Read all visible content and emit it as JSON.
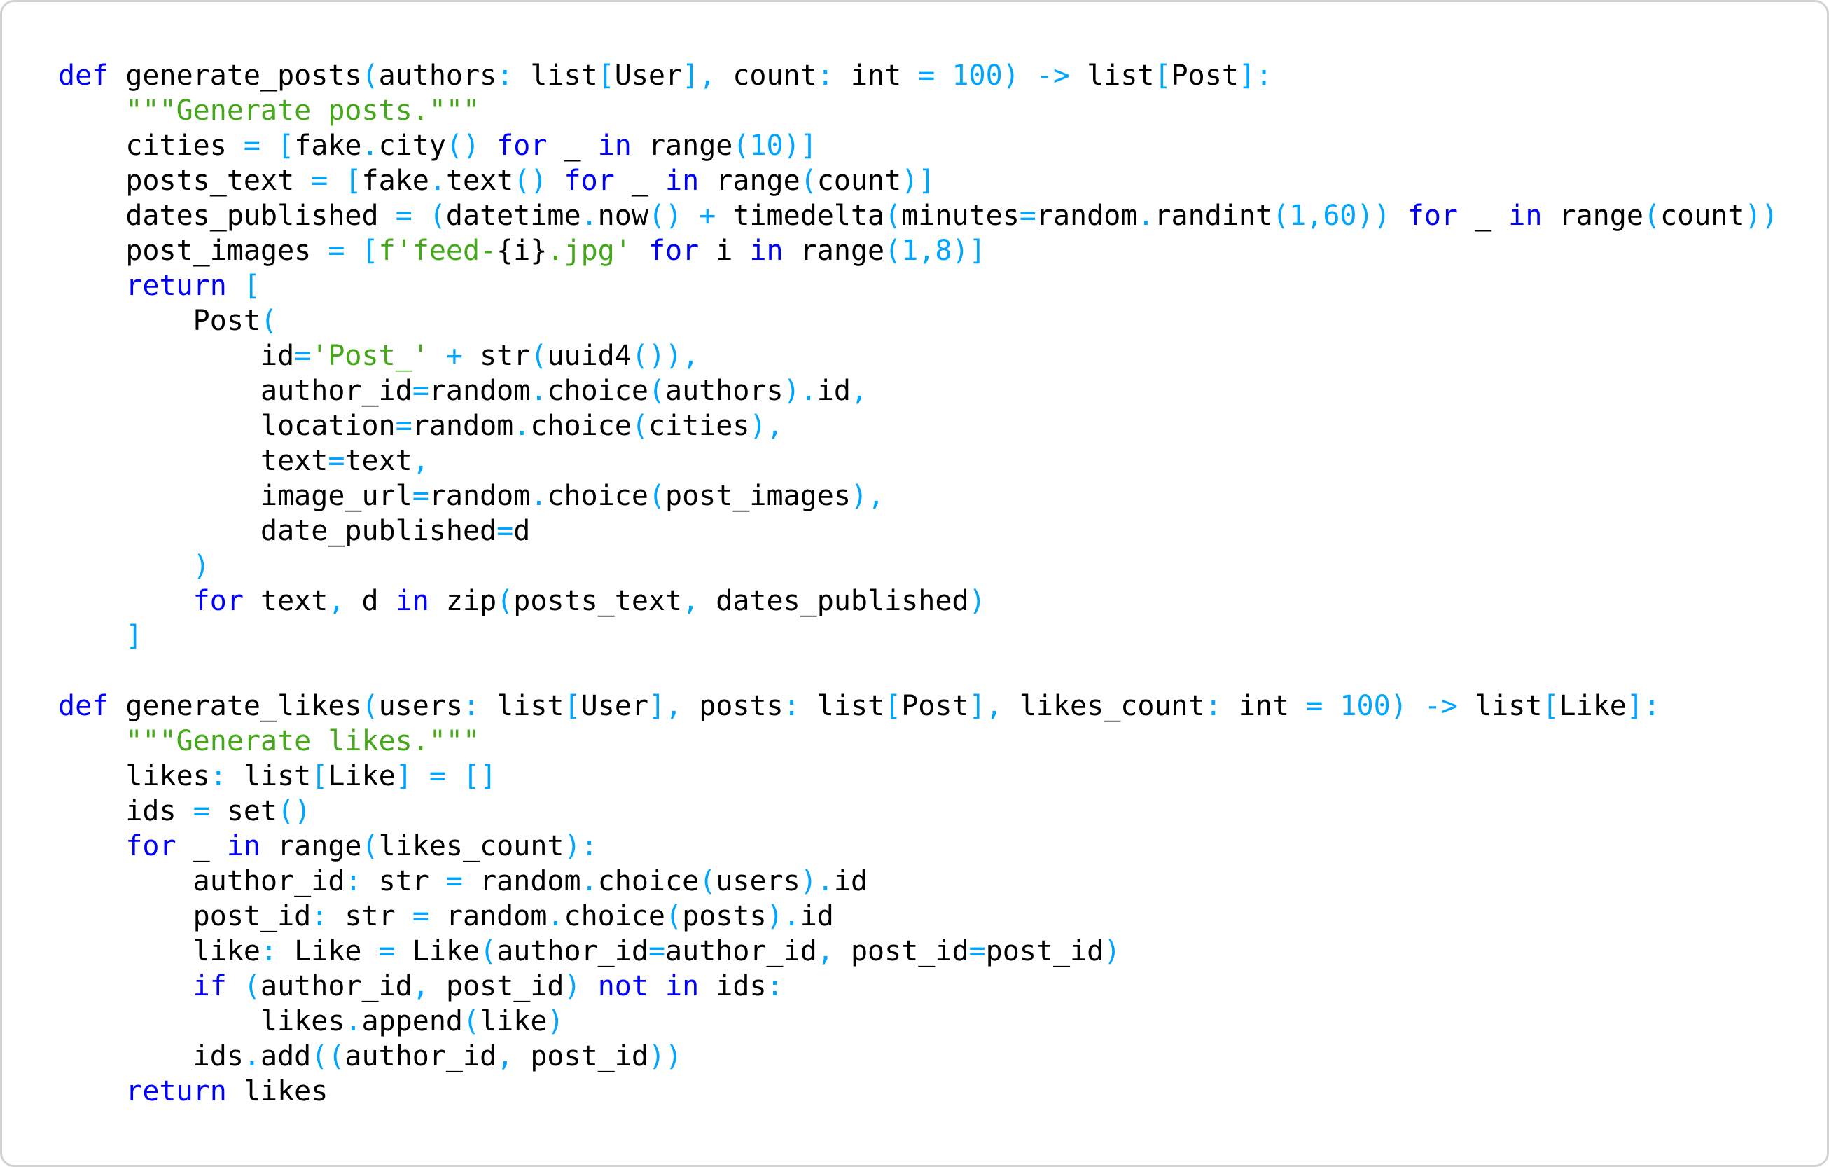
{
  "editor": {
    "language": "python",
    "colors": {
      "keyword": "#0000ff",
      "operator": "#00a5ff",
      "number": "#00a5ff",
      "string": "#44a81a",
      "text": "#000000",
      "background": "#ffffff",
      "border": "#d3d3d3"
    },
    "lines": [
      [
        [
          "kw",
          "def"
        ],
        [
          "tx",
          " generate_posts"
        ],
        [
          "op",
          "("
        ],
        [
          "tx",
          "authors"
        ],
        [
          "op",
          ":"
        ],
        [
          "tx",
          " list"
        ],
        [
          "op",
          "["
        ],
        [
          "tx",
          "User"
        ],
        [
          "op",
          "],"
        ],
        [
          "tx",
          " count"
        ],
        [
          "op",
          ":"
        ],
        [
          "tx",
          " int "
        ],
        [
          "op",
          "="
        ],
        [
          "tx",
          " "
        ],
        [
          "num",
          "100"
        ],
        [
          "op",
          ")"
        ],
        [
          "tx",
          " "
        ],
        [
          "op",
          "->"
        ],
        [
          "tx",
          " list"
        ],
        [
          "op",
          "["
        ],
        [
          "tx",
          "Post"
        ],
        [
          "op",
          "]:"
        ]
      ],
      [
        [
          "tx",
          "    "
        ],
        [
          "str",
          "\"\"\"Generate posts.\"\"\""
        ]
      ],
      [
        [
          "tx",
          "    cities "
        ],
        [
          "op",
          "="
        ],
        [
          "tx",
          " "
        ],
        [
          "op",
          "["
        ],
        [
          "tx",
          "fake"
        ],
        [
          "op",
          "."
        ],
        [
          "tx",
          "city"
        ],
        [
          "op",
          "()"
        ],
        [
          "tx",
          " "
        ],
        [
          "kw",
          "for"
        ],
        [
          "tx",
          " _ "
        ],
        [
          "kw",
          "in"
        ],
        [
          "tx",
          " range"
        ],
        [
          "op",
          "("
        ],
        [
          "num",
          "10"
        ],
        [
          "op",
          ")]"
        ]
      ],
      [
        [
          "tx",
          "    posts_text "
        ],
        [
          "op",
          "="
        ],
        [
          "tx",
          " "
        ],
        [
          "op",
          "["
        ],
        [
          "tx",
          "fake"
        ],
        [
          "op",
          "."
        ],
        [
          "tx",
          "text"
        ],
        [
          "op",
          "()"
        ],
        [
          "tx",
          " "
        ],
        [
          "kw",
          "for"
        ],
        [
          "tx",
          " _ "
        ],
        [
          "kw",
          "in"
        ],
        [
          "tx",
          " range"
        ],
        [
          "op",
          "("
        ],
        [
          "tx",
          "count"
        ],
        [
          "op",
          ")]"
        ]
      ],
      [
        [
          "tx",
          "    dates_published "
        ],
        [
          "op",
          "="
        ],
        [
          "tx",
          " "
        ],
        [
          "op",
          "("
        ],
        [
          "tx",
          "datetime"
        ],
        [
          "op",
          "."
        ],
        [
          "tx",
          "now"
        ],
        [
          "op",
          "()"
        ],
        [
          "tx",
          " "
        ],
        [
          "op",
          "+"
        ],
        [
          "tx",
          " timedelta"
        ],
        [
          "op",
          "("
        ],
        [
          "tx",
          "minutes"
        ],
        [
          "op",
          "="
        ],
        [
          "tx",
          "random"
        ],
        [
          "op",
          "."
        ],
        [
          "tx",
          "randint"
        ],
        [
          "op",
          "("
        ],
        [
          "num",
          "1"
        ],
        [
          "op",
          ","
        ],
        [
          "num",
          "60"
        ],
        [
          "op",
          "))"
        ],
        [
          "tx",
          " "
        ],
        [
          "kw",
          "for"
        ],
        [
          "tx",
          " _ "
        ],
        [
          "kw",
          "in"
        ],
        [
          "tx",
          " range"
        ],
        [
          "op",
          "("
        ],
        [
          "tx",
          "count"
        ],
        [
          "op",
          "))"
        ]
      ],
      [
        [
          "tx",
          "    post_images "
        ],
        [
          "op",
          "="
        ],
        [
          "tx",
          " "
        ],
        [
          "op",
          "["
        ],
        [
          "str",
          "f'feed-"
        ],
        [
          "tx",
          "{i}"
        ],
        [
          "str",
          ".jpg'"
        ],
        [
          "tx",
          " "
        ],
        [
          "kw",
          "for"
        ],
        [
          "tx",
          " i "
        ],
        [
          "kw",
          "in"
        ],
        [
          "tx",
          " range"
        ],
        [
          "op",
          "("
        ],
        [
          "num",
          "1"
        ],
        [
          "op",
          ","
        ],
        [
          "num",
          "8"
        ],
        [
          "op",
          ")]"
        ]
      ],
      [
        [
          "tx",
          "    "
        ],
        [
          "kw",
          "return"
        ],
        [
          "tx",
          " "
        ],
        [
          "op",
          "["
        ]
      ],
      [
        [
          "tx",
          "        Post"
        ],
        [
          "op",
          "("
        ]
      ],
      [
        [
          "tx",
          "            id"
        ],
        [
          "op",
          "="
        ],
        [
          "str",
          "'Post_'"
        ],
        [
          "tx",
          " "
        ],
        [
          "op",
          "+"
        ],
        [
          "tx",
          " str"
        ],
        [
          "op",
          "("
        ],
        [
          "tx",
          "uuid4"
        ],
        [
          "op",
          "()),"
        ]
      ],
      [
        [
          "tx",
          "            author_id"
        ],
        [
          "op",
          "="
        ],
        [
          "tx",
          "random"
        ],
        [
          "op",
          "."
        ],
        [
          "tx",
          "choice"
        ],
        [
          "op",
          "("
        ],
        [
          "tx",
          "authors"
        ],
        [
          "op",
          ")."
        ],
        [
          "tx",
          "id"
        ],
        [
          "op",
          ","
        ]
      ],
      [
        [
          "tx",
          "            location"
        ],
        [
          "op",
          "="
        ],
        [
          "tx",
          "random"
        ],
        [
          "op",
          "."
        ],
        [
          "tx",
          "choice"
        ],
        [
          "op",
          "("
        ],
        [
          "tx",
          "cities"
        ],
        [
          "op",
          "),"
        ]
      ],
      [
        [
          "tx",
          "            text"
        ],
        [
          "op",
          "="
        ],
        [
          "tx",
          "text"
        ],
        [
          "op",
          ","
        ]
      ],
      [
        [
          "tx",
          "            image_url"
        ],
        [
          "op",
          "="
        ],
        [
          "tx",
          "random"
        ],
        [
          "op",
          "."
        ],
        [
          "tx",
          "choice"
        ],
        [
          "op",
          "("
        ],
        [
          "tx",
          "post_images"
        ],
        [
          "op",
          "),"
        ]
      ],
      [
        [
          "tx",
          "            date_published"
        ],
        [
          "op",
          "="
        ],
        [
          "tx",
          "d"
        ]
      ],
      [
        [
          "tx",
          "        "
        ],
        [
          "op",
          ")"
        ]
      ],
      [
        [
          "tx",
          "        "
        ],
        [
          "kw",
          "for"
        ],
        [
          "tx",
          " text"
        ],
        [
          "op",
          ","
        ],
        [
          "tx",
          " d "
        ],
        [
          "kw",
          "in"
        ],
        [
          "tx",
          " zip"
        ],
        [
          "op",
          "("
        ],
        [
          "tx",
          "posts_text"
        ],
        [
          "op",
          ","
        ],
        [
          "tx",
          " dates_published"
        ],
        [
          "op",
          ")"
        ]
      ],
      [
        [
          "tx",
          "    "
        ],
        [
          "op",
          "]"
        ]
      ],
      [],
      [
        [
          "kw",
          "def"
        ],
        [
          "tx",
          " generate_likes"
        ],
        [
          "op",
          "("
        ],
        [
          "tx",
          "users"
        ],
        [
          "op",
          ":"
        ],
        [
          "tx",
          " list"
        ],
        [
          "op",
          "["
        ],
        [
          "tx",
          "User"
        ],
        [
          "op",
          "],"
        ],
        [
          "tx",
          " posts"
        ],
        [
          "op",
          ":"
        ],
        [
          "tx",
          " list"
        ],
        [
          "op",
          "["
        ],
        [
          "tx",
          "Post"
        ],
        [
          "op",
          "],"
        ],
        [
          "tx",
          " likes_count"
        ],
        [
          "op",
          ":"
        ],
        [
          "tx",
          " int "
        ],
        [
          "op",
          "="
        ],
        [
          "tx",
          " "
        ],
        [
          "num",
          "100"
        ],
        [
          "op",
          ")"
        ],
        [
          "tx",
          " "
        ],
        [
          "op",
          "->"
        ],
        [
          "tx",
          " list"
        ],
        [
          "op",
          "["
        ],
        [
          "tx",
          "Like"
        ],
        [
          "op",
          "]:"
        ]
      ],
      [
        [
          "tx",
          "    "
        ],
        [
          "str",
          "\"\"\"Generate likes.\"\"\""
        ]
      ],
      [
        [
          "tx",
          "    likes"
        ],
        [
          "op",
          ":"
        ],
        [
          "tx",
          " list"
        ],
        [
          "op",
          "["
        ],
        [
          "tx",
          "Like"
        ],
        [
          "op",
          "]"
        ],
        [
          "tx",
          " "
        ],
        [
          "op",
          "="
        ],
        [
          "tx",
          " "
        ],
        [
          "op",
          "[]"
        ]
      ],
      [
        [
          "tx",
          "    ids "
        ],
        [
          "op",
          "="
        ],
        [
          "tx",
          " set"
        ],
        [
          "op",
          "()"
        ]
      ],
      [
        [
          "tx",
          "    "
        ],
        [
          "kw",
          "for"
        ],
        [
          "tx",
          " _ "
        ],
        [
          "kw",
          "in"
        ],
        [
          "tx",
          " range"
        ],
        [
          "op",
          "("
        ],
        [
          "tx",
          "likes_count"
        ],
        [
          "op",
          "):"
        ]
      ],
      [
        [
          "tx",
          "        author_id"
        ],
        [
          "op",
          ":"
        ],
        [
          "tx",
          " str "
        ],
        [
          "op",
          "="
        ],
        [
          "tx",
          " random"
        ],
        [
          "op",
          "."
        ],
        [
          "tx",
          "choice"
        ],
        [
          "op",
          "("
        ],
        [
          "tx",
          "users"
        ],
        [
          "op",
          ")."
        ],
        [
          "tx",
          "id"
        ]
      ],
      [
        [
          "tx",
          "        post_id"
        ],
        [
          "op",
          ":"
        ],
        [
          "tx",
          " str "
        ],
        [
          "op",
          "="
        ],
        [
          "tx",
          " random"
        ],
        [
          "op",
          "."
        ],
        [
          "tx",
          "choice"
        ],
        [
          "op",
          "("
        ],
        [
          "tx",
          "posts"
        ],
        [
          "op",
          ")."
        ],
        [
          "tx",
          "id"
        ]
      ],
      [
        [
          "tx",
          "        like"
        ],
        [
          "op",
          ":"
        ],
        [
          "tx",
          " Like "
        ],
        [
          "op",
          "="
        ],
        [
          "tx",
          " Like"
        ],
        [
          "op",
          "("
        ],
        [
          "tx",
          "author_id"
        ],
        [
          "op",
          "="
        ],
        [
          "tx",
          "author_id"
        ],
        [
          "op",
          ","
        ],
        [
          "tx",
          " post_id"
        ],
        [
          "op",
          "="
        ],
        [
          "tx",
          "post_id"
        ],
        [
          "op",
          ")"
        ]
      ],
      [
        [
          "tx",
          "        "
        ],
        [
          "kw",
          "if"
        ],
        [
          "tx",
          " "
        ],
        [
          "op",
          "("
        ],
        [
          "tx",
          "author_id"
        ],
        [
          "op",
          ","
        ],
        [
          "tx",
          " post_id"
        ],
        [
          "op",
          ")"
        ],
        [
          "tx",
          " "
        ],
        [
          "kw",
          "not"
        ],
        [
          "tx",
          " "
        ],
        [
          "kw",
          "in"
        ],
        [
          "tx",
          " ids"
        ],
        [
          "op",
          ":"
        ]
      ],
      [
        [
          "tx",
          "            likes"
        ],
        [
          "op",
          "."
        ],
        [
          "tx",
          "append"
        ],
        [
          "op",
          "("
        ],
        [
          "tx",
          "like"
        ],
        [
          "op",
          ")"
        ]
      ],
      [
        [
          "tx",
          "        ids"
        ],
        [
          "op",
          "."
        ],
        [
          "tx",
          "add"
        ],
        [
          "op",
          "(("
        ],
        [
          "tx",
          "author_id"
        ],
        [
          "op",
          ","
        ],
        [
          "tx",
          " post_id"
        ],
        [
          "op",
          "))"
        ]
      ],
      [
        [
          "tx",
          "    "
        ],
        [
          "kw",
          "return"
        ],
        [
          "tx",
          " likes"
        ]
      ]
    ]
  }
}
